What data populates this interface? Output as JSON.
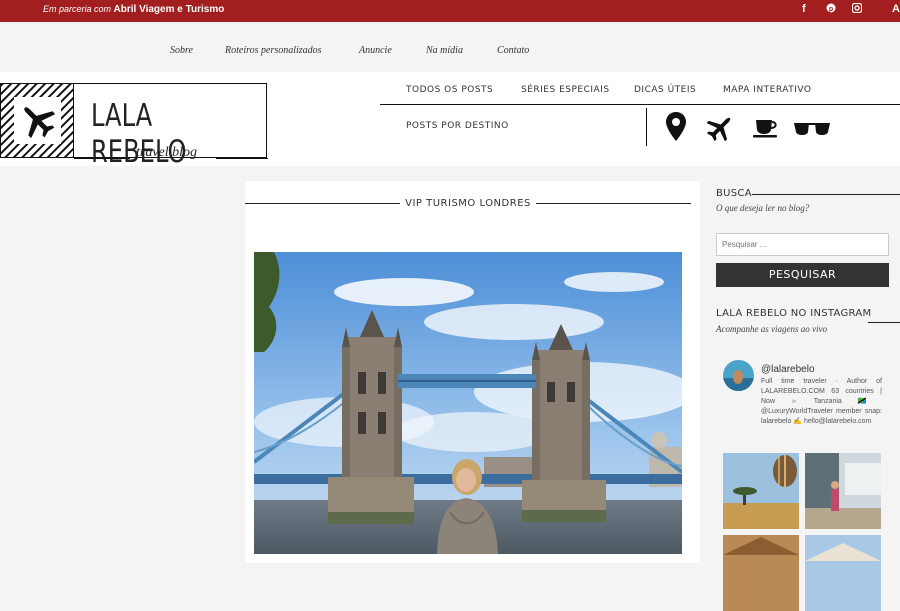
{
  "topbar": {
    "partner_prefix": "Em parceria com",
    "partner_name": "Abril Viagem e Turismo",
    "social": [
      "facebook-icon",
      "pinterest-icon",
      "instagram-icon"
    ],
    "social_glyphs": [
      "f",
      "℗",
      "◙",
      "A"
    ]
  },
  "subnav": {
    "items": [
      "Sobre",
      "Roteiros personalizados",
      "Anuncie",
      "Na mídia",
      "Contato"
    ]
  },
  "logo": {
    "name": "LALA REBELO",
    "tagline": "travel blog"
  },
  "mainnav": {
    "items": [
      "TODOS OS POSTS",
      "SÉRIES ESPECIAIS",
      "DICAS ÚTEIS",
      "MAPA INTERATIVO",
      "POSTS POR DESTINO"
    ],
    "icons": [
      "map-pin-icon",
      "airplane-icon",
      "coffee-cup-icon",
      "sunglasses-icon"
    ]
  },
  "post": {
    "title": "VIP TURISMO LONDRES"
  },
  "sidebar": {
    "search_title": "BUSCA",
    "search_subtitle": "O que deseja ler no blog?",
    "search_placeholder": "Pesquisar ...",
    "search_button": "PESQUISAR",
    "insta_title": "LALA REBELO NO INSTAGRAM",
    "insta_subtitle": "Acompanhe as viagens ao vivo",
    "insta_user": "@lalarebelo",
    "insta_bio": "Full time traveler · Author of LALAREBELO.COM 63 countries | Now ▹ Tanzania🇹🇿 @LuxuryWorldTraveler member snap: lalarebelo ✍ hello@lalarebelo.com"
  },
  "colors": {
    "brand_red": "#a31f1f",
    "button_dark": "#333333"
  }
}
